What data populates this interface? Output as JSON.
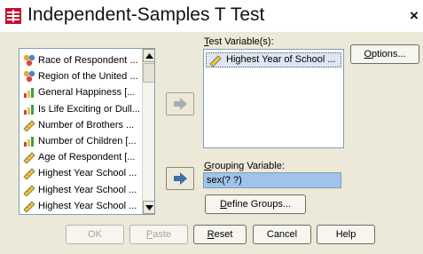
{
  "window": {
    "title": "Independent-Samples T Test",
    "close": "×"
  },
  "source_list": {
    "items": [
      {
        "label": "Race of Respondent ...",
        "icon": "nominal-icon"
      },
      {
        "label": "Region of the United ...",
        "icon": "nominal-icon"
      },
      {
        "label": "General Happiness [...",
        "icon": "ordinal-icon"
      },
      {
        "label": "Is Life Exciting or Dull...",
        "icon": "ordinal-icon"
      },
      {
        "label": "Number of Brothers ...",
        "icon": "scale-icon"
      },
      {
        "label": "Number of Children [...",
        "icon": "ordinal-icon"
      },
      {
        "label": "Age of Respondent [...",
        "icon": "scale-icon"
      },
      {
        "label": "Highest Year School ...",
        "icon": "scale-icon"
      },
      {
        "label": "Highest Year School ...",
        "icon": "scale-icon"
      },
      {
        "label": "Highest Year School ...",
        "icon": "scale-icon"
      }
    ]
  },
  "test_variables": {
    "label_first": "T",
    "label_rest": "est Variable(s):",
    "items": [
      {
        "label": "Highest Year of School ...",
        "icon": "scale-icon"
      }
    ]
  },
  "grouping": {
    "label_first": "G",
    "label_rest": "rouping Variable:",
    "value": "sex(? ?)"
  },
  "buttons": {
    "options_first": "O",
    "options_rest": "ptions...",
    "define_first": "D",
    "define_rest": "efine Groups...",
    "ok": "OK",
    "paste_first": "P",
    "paste_rest": "aste",
    "reset_first": "R",
    "reset_rest": "eset",
    "cancel": "Cancel",
    "help": "Help"
  },
  "colors": {
    "selection": "#9fc3ea",
    "dialog_bg": "#ece9d8",
    "arrow": "#7b8ca0"
  }
}
